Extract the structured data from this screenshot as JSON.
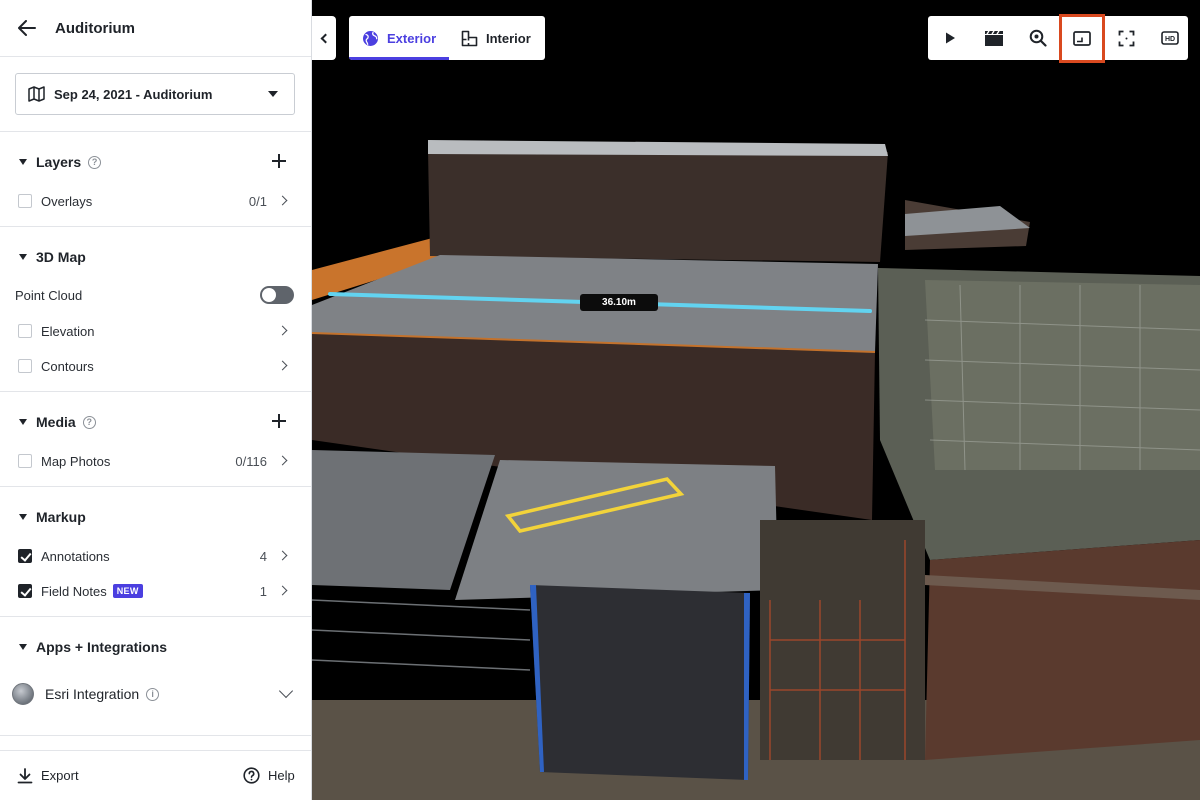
{
  "sidebar": {
    "title": "Auditorium",
    "date_selector": {
      "value": "Sep 24, 2021 - Auditorium"
    },
    "layers": {
      "title": "Layers",
      "items": [
        {
          "label": "Overlays",
          "count": "0/1",
          "checked": false
        }
      ]
    },
    "map3d": {
      "title": "3D Map",
      "point_cloud_label": "Point Cloud",
      "point_cloud_on": false,
      "items": [
        {
          "label": "Elevation",
          "checked": false
        },
        {
          "label": "Contours",
          "checked": false
        }
      ]
    },
    "media": {
      "title": "Media",
      "items": [
        {
          "label": "Map Photos",
          "count": "0/116",
          "checked": false
        }
      ]
    },
    "markup": {
      "title": "Markup",
      "items": [
        {
          "label": "Annotations",
          "count": "4",
          "checked": true
        },
        {
          "label": "Field Notes",
          "badge": "NEW",
          "count": "1",
          "checked": true
        }
      ]
    },
    "apps": {
      "title": "Apps + Integrations",
      "items": [
        {
          "label": "Esri Integration"
        }
      ]
    },
    "footer": {
      "export_label": "Export",
      "help_label": "Help"
    }
  },
  "viewer": {
    "tabs": [
      {
        "label": "Exterior",
        "active": true,
        "icon": "globe-icon"
      },
      {
        "label": "Interior",
        "active": false,
        "icon": "floorplan-icon"
      }
    ],
    "toolbar": [
      {
        "icon": "play-icon"
      },
      {
        "icon": "clapperboard-icon"
      },
      {
        "icon": "zoom-icon"
      },
      {
        "icon": "picture-in-picture-icon",
        "highlighted": true
      },
      {
        "icon": "fullscreen-icon"
      },
      {
        "icon": "hd-icon",
        "text": "HD"
      }
    ],
    "measurement": {
      "value": "36.10m",
      "color": "#62d3f0"
    },
    "annotation_color": "#f2d33a",
    "accent": "#4b3fe0",
    "highlight_color": "#d9491f"
  }
}
